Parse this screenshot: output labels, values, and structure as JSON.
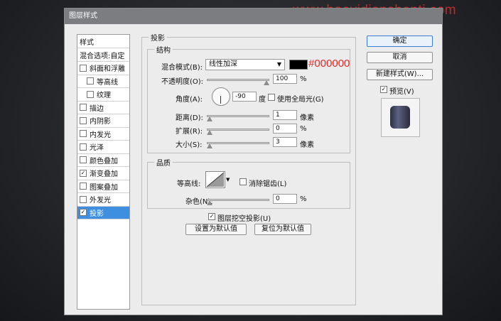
{
  "watermark": "www.haoyidianshenti.com",
  "window_title": "图层样式",
  "styles_list": {
    "header": "样式",
    "blend_options": "混合选项:自定",
    "items": [
      {
        "label": "斜面和浮雕",
        "checked": false,
        "indent": false
      },
      {
        "label": "等高线",
        "checked": false,
        "indent": true
      },
      {
        "label": "纹理",
        "checked": false,
        "indent": true
      },
      {
        "label": "描边",
        "checked": false,
        "indent": false
      },
      {
        "label": "内阴影",
        "checked": false,
        "indent": false
      },
      {
        "label": "内发光",
        "checked": false,
        "indent": false
      },
      {
        "label": "光泽",
        "checked": false,
        "indent": false
      },
      {
        "label": "颜色叠加",
        "checked": false,
        "indent": false
      },
      {
        "label": "渐变叠加",
        "checked": true,
        "indent": false
      },
      {
        "label": "图案叠加",
        "checked": false,
        "indent": false
      },
      {
        "label": "外发光",
        "checked": false,
        "indent": false
      },
      {
        "label": "投影",
        "checked": true,
        "indent": false,
        "selected": true
      }
    ]
  },
  "drop_shadow": {
    "section_title": "投影",
    "structure_title": "结构",
    "blend_mode_label": "混合模式(B):",
    "blend_mode_value": "线性加深",
    "color_hex": "#000000",
    "opacity_label": "不透明度(O):",
    "opacity_value": "100",
    "opacity_unit": "%",
    "angle_label": "角度(A):",
    "angle_value": "-90",
    "angle_unit": "度",
    "global_light_label": "使用全局光(G)",
    "global_light_checked": false,
    "distance_label": "距离(D):",
    "distance_value": "1",
    "distance_unit": "像素",
    "spread_label": "扩展(R):",
    "spread_value": "0",
    "spread_unit": "%",
    "size_label": "大小(S):",
    "size_value": "3",
    "size_unit": "像素",
    "quality_title": "品质",
    "contour_label": "等高线:",
    "antialias_label": "消除锯齿(L)",
    "antialias_checked": false,
    "noise_label": "杂色(N):",
    "noise_value": "0",
    "noise_unit": "%",
    "knockout_label": "图层挖空投影(U)",
    "knockout_checked": true,
    "make_default": "设置为默认值",
    "reset_default": "复位为默认值"
  },
  "buttons": {
    "ok": "确定",
    "cancel": "取消",
    "new_style": "新建样式(W)..."
  },
  "preview": {
    "label": "预览(V)",
    "checked": true
  },
  "slider_levels": {
    "opacity": 1.0,
    "distance": 0.0,
    "spread": 0.0,
    "size": 0.0,
    "noise": 0.0
  },
  "colors": {
    "selected_row": "#3f8fe0",
    "swatch": "#000000",
    "annotation": "#e02a2a"
  }
}
